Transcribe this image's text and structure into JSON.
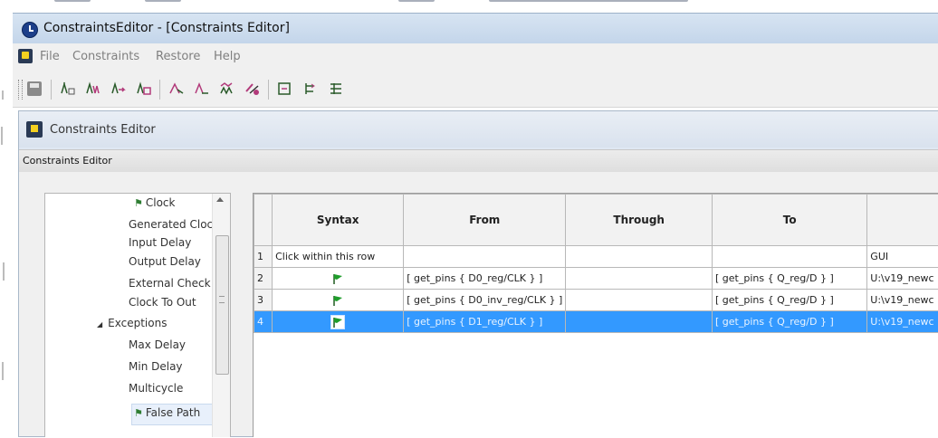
{
  "window": {
    "title": "ConstraintsEditor - [Constraints Editor]"
  },
  "menu": {
    "items": [
      "File",
      "Constraints",
      "Restore",
      "Help"
    ]
  },
  "toolbar": {
    "icons": [
      "save-icon",
      "clock-icon",
      "generated-clock-icon",
      "input-delay-icon",
      "output-delay-icon",
      "external-check-icon",
      "clock-to-out-icon",
      "max-delay-icon",
      "false-path-icon",
      "multicycle-icon",
      "tree-icon",
      "grid-icon"
    ]
  },
  "child": {
    "title": "Constraints Editor",
    "strip_label": "Constraints Editor"
  },
  "tree": {
    "items": [
      {
        "label": "Clock",
        "flag": true
      },
      {
        "label": "Generated Clock"
      },
      {
        "label": "Input Delay"
      },
      {
        "label": "Output Delay"
      },
      {
        "label": "External Check"
      },
      {
        "label": "Clock To Out"
      },
      {
        "label": "Exceptions",
        "expander": "◢"
      },
      {
        "label": "Max Delay"
      },
      {
        "label": "Min Delay"
      },
      {
        "label": "Multicycle"
      },
      {
        "label": "False Path",
        "flag": true,
        "selected": true
      }
    ]
  },
  "grid": {
    "columns": [
      "",
      "Syntax",
      "From",
      "Through",
      "To",
      ""
    ],
    "rows": [
      {
        "num": "1",
        "syntax": "Click within this row",
        "from": "",
        "through": "",
        "to": "",
        "extra": "GUI"
      },
      {
        "num": "2",
        "syntax": "flag",
        "from": "[ get_pins { D0_reg/CLK } ]",
        "through": "",
        "to": "[ get_pins { Q_reg/D } ]",
        "extra": "U:\\v19_newc"
      },
      {
        "num": "3",
        "syntax": "flag",
        "from": "[ get_pins { D0_inv_reg/CLK } ]",
        "through": "",
        "to": "[ get_pins { Q_reg/D } ]",
        "extra": "U:\\v19_newc"
      },
      {
        "num": "4",
        "syntax": "flag",
        "from": "[ get_pins { D1_reg/CLK } ]",
        "through": "",
        "to": "[ get_pins { Q_reg/D } ]",
        "extra": "U:\\v19_newc",
        "selected": true
      }
    ]
  },
  "colors": {
    "selection": "#3399ff",
    "flag_green": "#1f9d2b"
  }
}
